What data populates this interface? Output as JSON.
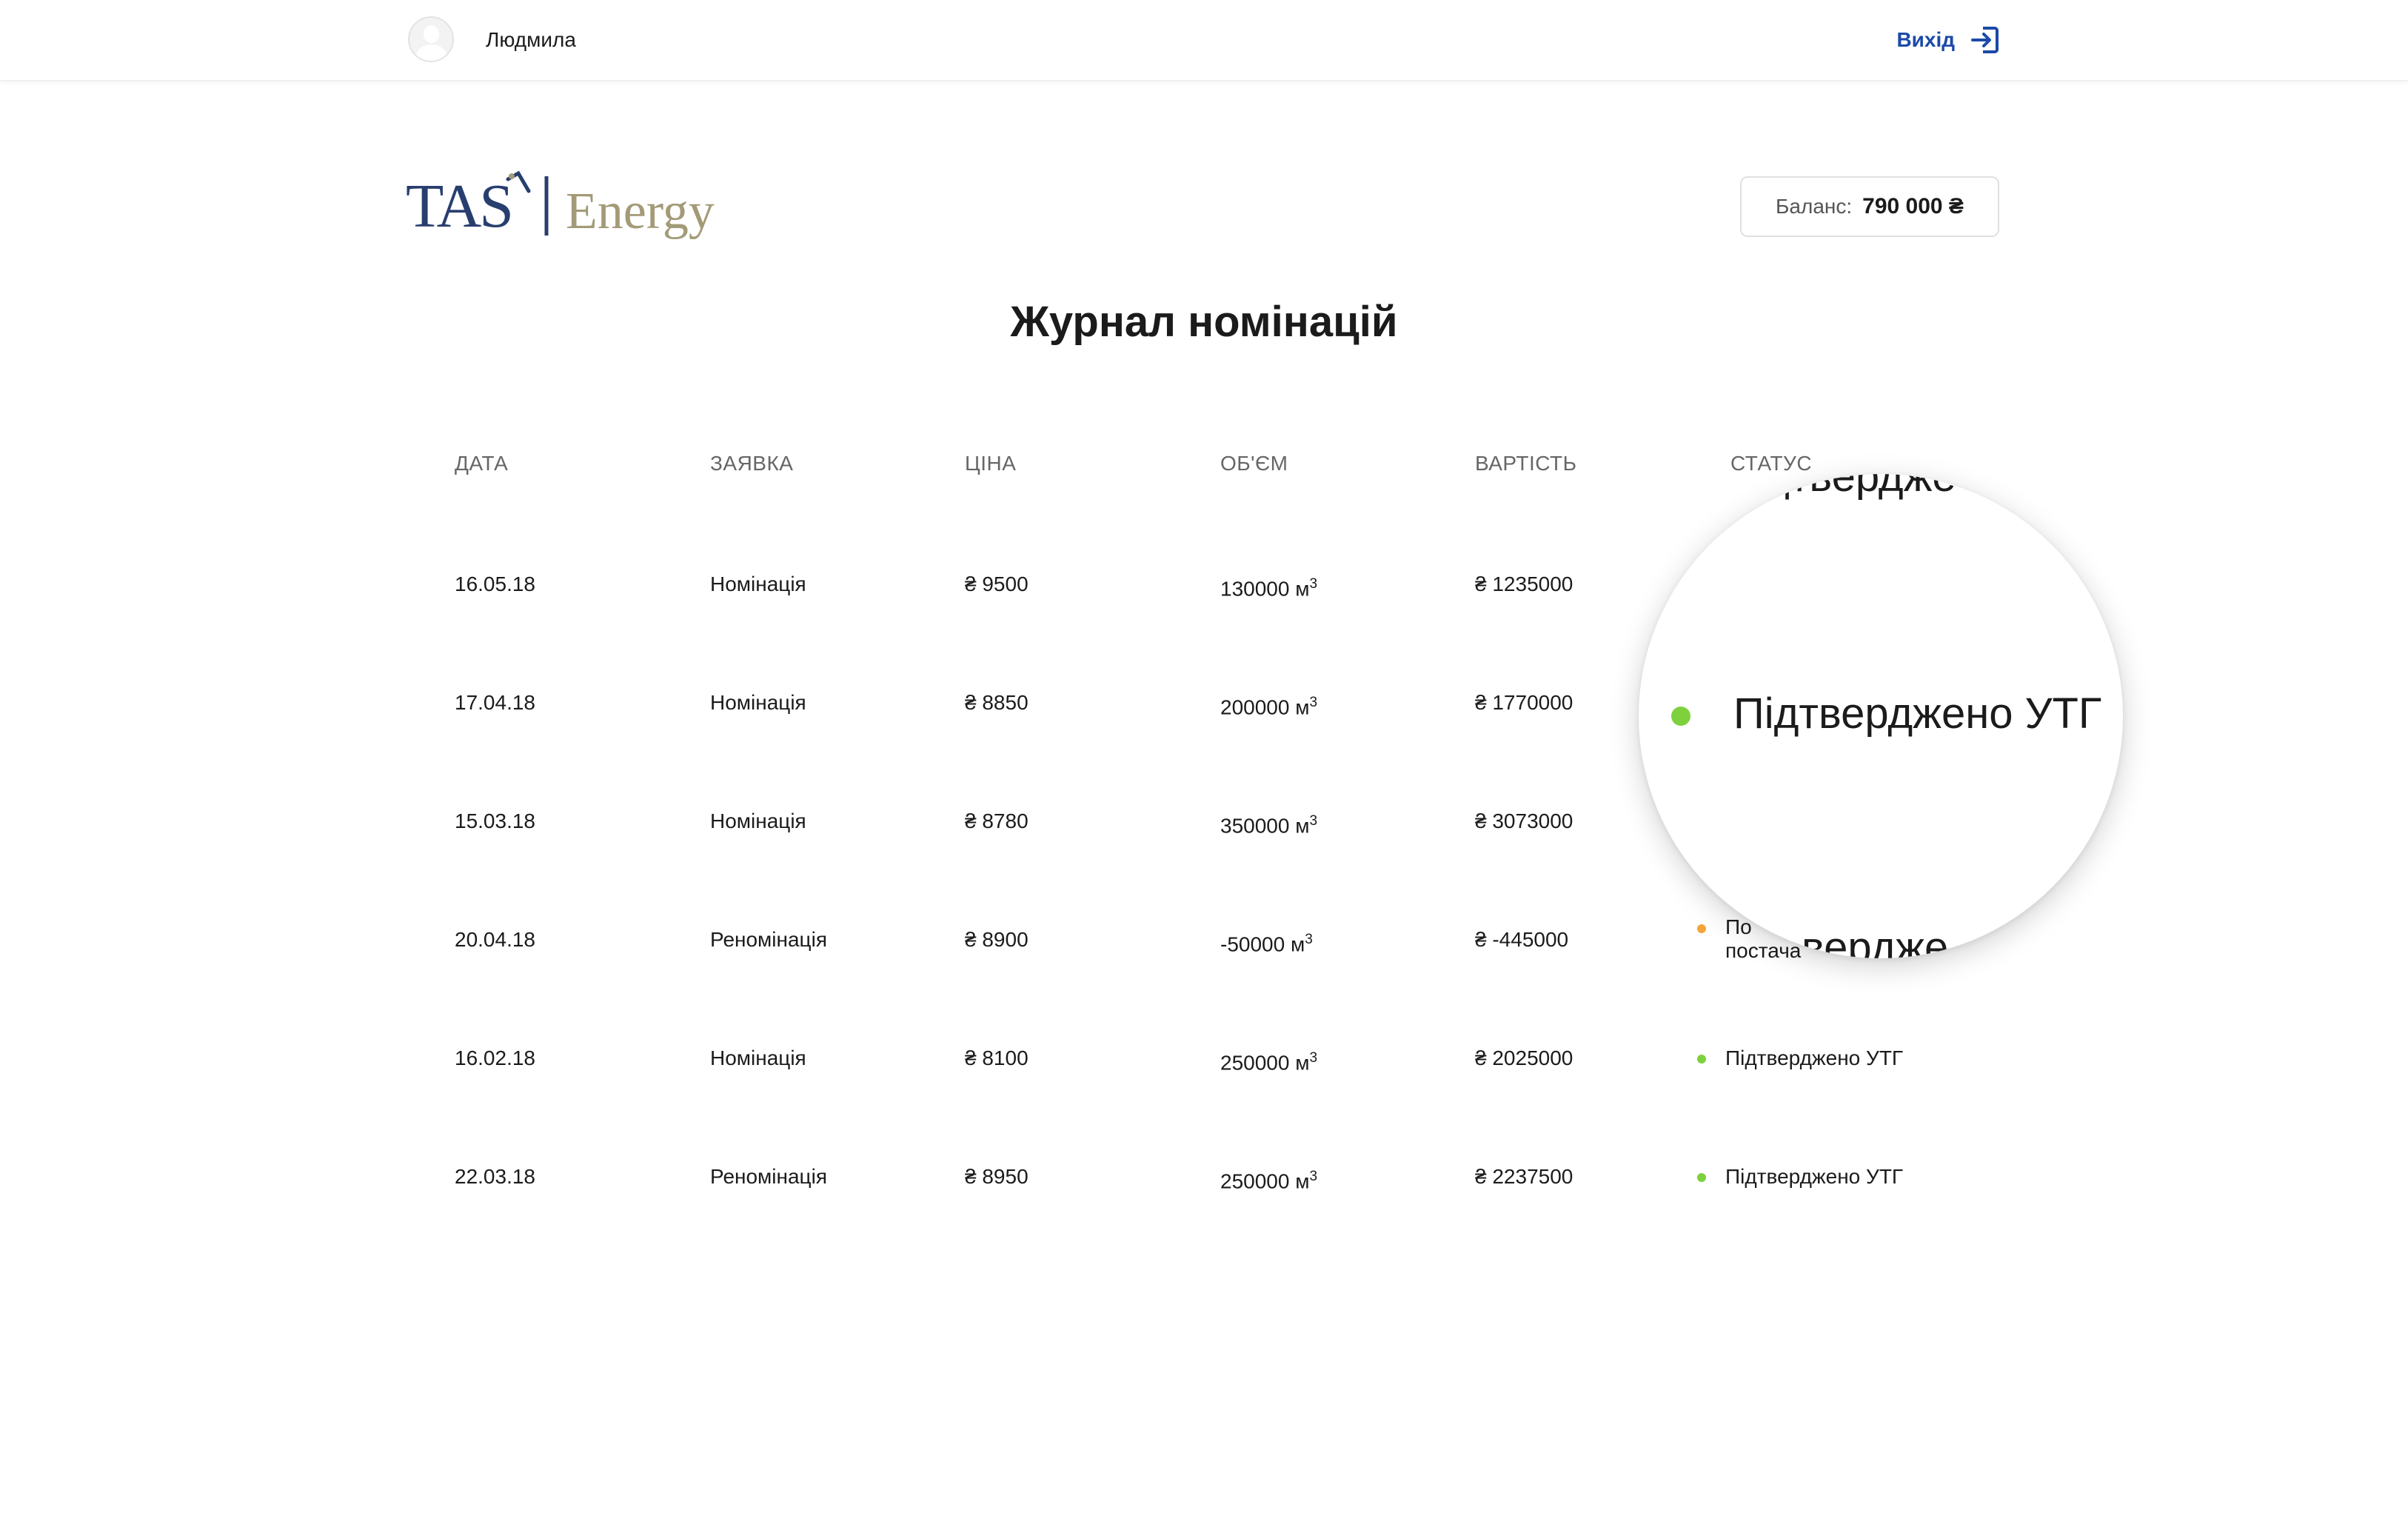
{
  "header": {
    "username": "Людмила",
    "logout_label": "Вихід"
  },
  "logo": {
    "brand_text": "TAS",
    "brand_sub": "Energy"
  },
  "balance": {
    "label": "Баланс:",
    "value": "790 000 ₴"
  },
  "page_title": "Журнал номінацій",
  "table": {
    "columns": [
      "ДАТА",
      "ЗАЯВКА",
      "ЦІНА",
      "ОБ'ЄМ",
      "ВАРТІСТЬ",
      "СТАТУС"
    ],
    "rows": [
      {
        "date": "16.05.18",
        "type": "Номінація",
        "price": "₴ 9500",
        "volume": "130000 м",
        "cost": "₴ 1235000",
        "status": ""
      },
      {
        "date": "17.04.18",
        "type": "Номінація",
        "price": "₴ 8850",
        "volume": "200000 м",
        "cost": "₴ 1770000",
        "status": ""
      },
      {
        "date": "15.03.18",
        "type": "Номінація",
        "price": "₴ 8780",
        "volume": "350000 м",
        "cost": "₴ 3073000",
        "status": ""
      },
      {
        "date": "20.04.18",
        "type": "Реномінація",
        "price": "₴ 8900",
        "volume": "-50000 м",
        "cost": "₴ -445000",
        "status": "По\nпостача"
      },
      {
        "date": "16.02.18",
        "type": "Номінація",
        "price": "₴ 8100",
        "volume": "250000 м",
        "cost": "₴ 2025000",
        "status": "Підтверджено УТГ"
      },
      {
        "date": "22.03.18",
        "type": "Реномінація",
        "price": "₴ 8950",
        "volume": "250000 м",
        "cost": "₴ 2237500",
        "status": "Підтверджено УТГ"
      }
    ],
    "volume_unit_exponent": "3"
  },
  "magnifier": {
    "top_fragment": "дтвердже",
    "main_status": "Підтверджено УТГ",
    "bottom_fragment": "вердже"
  },
  "colors": {
    "brand_navy": "#283e6e",
    "brand_gold": "#a39a78",
    "link_blue": "#1b4aa8",
    "status_confirmed": "#7ed13c",
    "status_pending": "#f5a43a"
  },
  "icons": {
    "logout": "logout-arrow-icon",
    "avatar": "user-avatar-icon"
  }
}
